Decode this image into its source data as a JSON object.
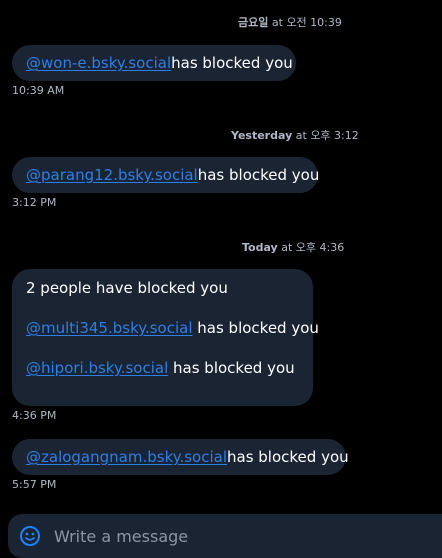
{
  "colors": {
    "background": "#000000",
    "bubble": "#1b2433",
    "mention": "#2d7fe8",
    "meta_text": "#aeb9c5",
    "accent": "#1a83ff"
  },
  "day_separators": [
    {
      "day": "금요일",
      "at": "at",
      "time": "오전 10:39"
    },
    {
      "day": "Yesterday",
      "at": "at",
      "time": "오후 3:12"
    },
    {
      "day": "Today",
      "at": "at",
      "time": "오후 4:36"
    }
  ],
  "messages": [
    {
      "mention": "@won-e.bsky.social",
      "suffix": " has blocked you",
      "time": "10:39 AM"
    },
    {
      "mention": "@parang12.bsky.social",
      "suffix": " has blocked you",
      "time": "3:12 PM"
    },
    {
      "header": "2 people have blocked you",
      "lines": [
        {
          "mention": "@multi345.bsky.social",
          "suffix": " has blocked you"
        },
        {
          "mention": "@hipori.bsky.social",
          "suffix": " has blocked you"
        }
      ],
      "time": "4:36 PM"
    },
    {
      "mention": "@zalogangnam.bsky.social",
      "suffix": " has blocked you",
      "time": "5:57 PM"
    }
  ],
  "composer": {
    "icon": "emoji-smile-icon",
    "placeholder": "Write a message"
  }
}
